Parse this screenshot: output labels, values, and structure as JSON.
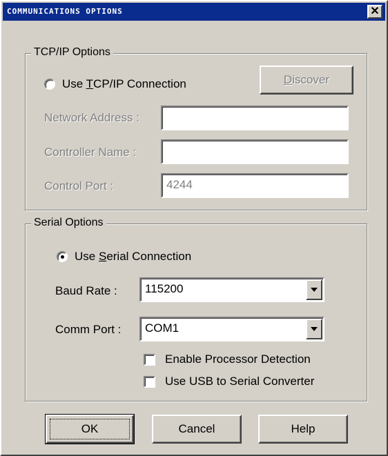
{
  "window": {
    "title": "COMMUNICATIONS OPTIONS"
  },
  "tcpip": {
    "legend": "TCP/IP Options",
    "radio_label_prefix": "Use ",
    "radio_label_accel": "T",
    "radio_label_suffix": "CP/IP Connection",
    "radio_selected": false,
    "discover_accel": "D",
    "discover_rest": "iscover",
    "network_address_label": "Network Address :",
    "network_address_value": "",
    "controller_name_label": "Controller Name :",
    "controller_name_value": "",
    "control_port_label": "Control Port :",
    "control_port_value": "4244"
  },
  "serial": {
    "legend": "Serial Options",
    "radio_label_prefix": "Use ",
    "radio_label_accel": "S",
    "radio_label_suffix": "erial Connection",
    "radio_selected": true,
    "baud_rate_label": "Baud Rate :",
    "baud_rate_value": "115200",
    "comm_port_label": "Comm Port :",
    "comm_port_value": "COM1",
    "enable_processor_detection_label": "Enable Processor Detection",
    "enable_processor_detection_checked": false,
    "usb_serial_label": "Use USB to Serial Converter",
    "usb_serial_checked": false
  },
  "buttons": {
    "ok": "OK",
    "cancel": "Cancel",
    "help": "Help"
  },
  "icons": {
    "close": "close-icon",
    "dropdown": "chevron-down-icon",
    "radio_dot": "radio-dot-icon"
  }
}
